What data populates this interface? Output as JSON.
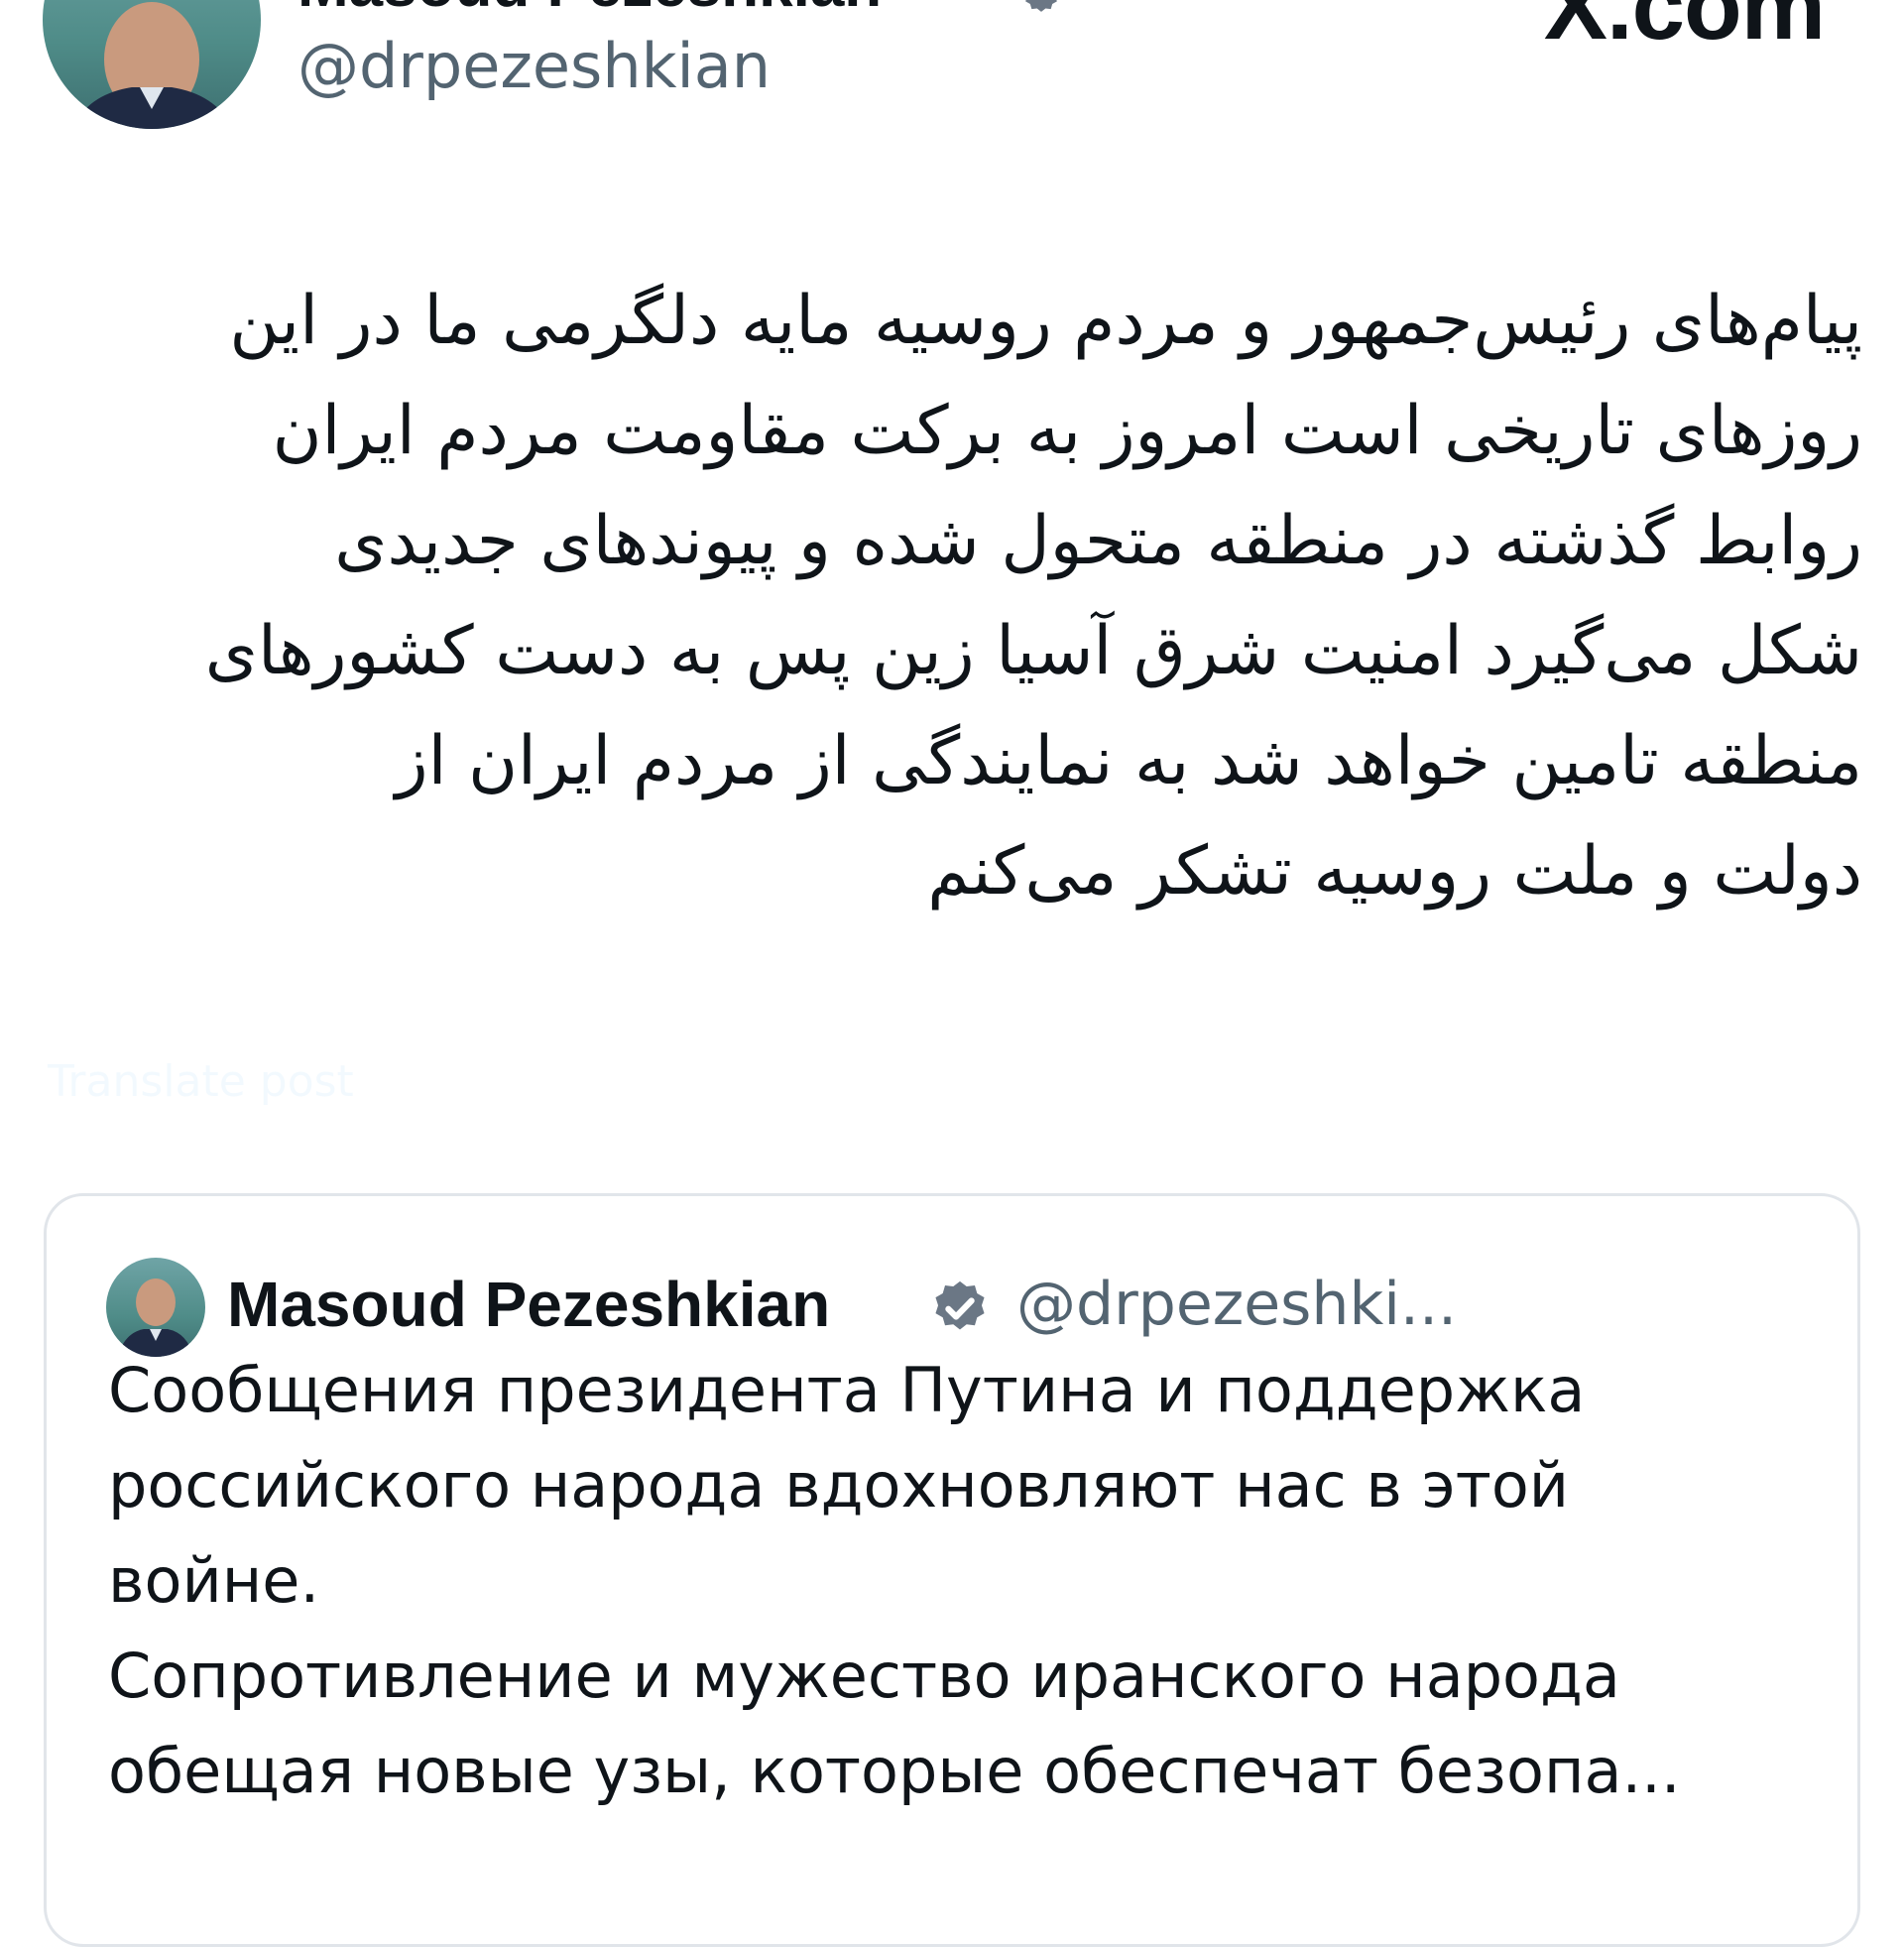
{
  "header": {
    "display_name": "Masoud Pezeshkian",
    "handle": "@drpezeshkian",
    "site_brand": "X.com"
  },
  "post": {
    "lines": [
      "پیام‌های رئیس‌جمهور و مردم روسیه مایه دلگرمی ما در این",
      "روزهای تاریخی است امروز به برکت مقاومت مردم ایران",
      "روابط گذشته در منطقه متحول شده و پیوندهای جدیدی",
      "شکل می‌گیرد امنیت شرق آسیا زین پس به دست کشورهای",
      "منطقه تامین خواهد شد به نمایندگی از مردم ایران از",
      "دولت و ملت روسیه تشکر می‌کنم"
    ]
  },
  "translate_link": "Translate post",
  "quote": {
    "display_name": "Masoud Pezeshkian",
    "handle": "@drpezeshki...",
    "lines": [
      "Сообщения президента Путина и поддержка",
      "российского народа вдохновляют нас в этой",
      "войне.",
      "Сопротивление и мужество иранского народа",
      "обещая новые узы, которые обеспечат безопа..."
    ]
  },
  "colors": {
    "text": "#0f1419",
    "secondary": "#536471",
    "verified": "#6b7785",
    "card_border": "#e1e5ea",
    "avatar_bg": "#5a9593"
  },
  "icons": {
    "verified": "verified-badge-icon"
  }
}
